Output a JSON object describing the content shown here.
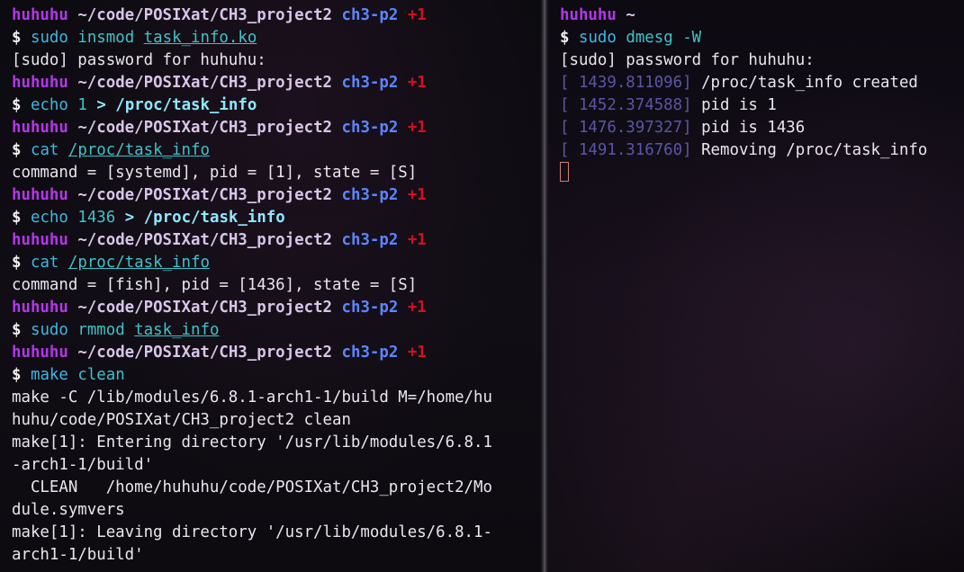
{
  "left": {
    "prompt": {
      "user": "huhuhu",
      "path": "~/code/POSIXat/CH3_project2",
      "branch": "ch3-p2",
      "dirty": "+1",
      "symbol": "$"
    },
    "cmd1": {
      "cmd": "sudo",
      "arg": "insmod",
      "target": "task_info.ko"
    },
    "out1": "[sudo] password for huhuhu:",
    "cmd2": {
      "cmd": "echo",
      "arg": "1",
      "op": ">",
      "target": "/proc/task_info"
    },
    "cmd3": {
      "cmd": "cat",
      "target": "/proc/task_info"
    },
    "out3": "command = [systemd], pid = [1], state = [S]",
    "cmd4": {
      "cmd": "echo",
      "arg": "1436",
      "op": ">",
      "target": "/proc/task_info"
    },
    "cmd5": {
      "cmd": "cat",
      "target": "/proc/task_info"
    },
    "out5": "command = [fish], pid = [1436], state = [S]",
    "cmd6": {
      "cmd": "sudo",
      "arg": "rmmod",
      "target": "task_info"
    },
    "cmd7": {
      "cmd": "make",
      "arg": "clean"
    },
    "out7": [
      "make -C /lib/modules/6.8.1-arch1-1/build M=/home/hu",
      "huhu/code/POSIXat/CH3_project2 clean",
      "make[1]: Entering directory '/usr/lib/modules/6.8.1",
      "-arch1-1/build'",
      "  CLEAN   /home/huhuhu/code/POSIXat/CH3_project2/Mo",
      "dule.symvers",
      "make[1]: Leaving directory '/usr/lib/modules/6.8.1-",
      "arch1-1/build'"
    ]
  },
  "right": {
    "prompt": {
      "user": "huhuhu",
      "path": "~",
      "symbol": "$"
    },
    "cmd": {
      "cmd": "sudo",
      "arg": "dmesg",
      "flag": "-W"
    },
    "out1": "[sudo] password for huhuhu:",
    "log": [
      {
        "ts": "[ 1439.811096]",
        "msg": "/proc/task_info created"
      },
      {
        "ts": "[ 1452.374588]",
        "msg": "pid is 1"
      },
      {
        "ts": "[ 1476.397327]",
        "msg": "pid is 1436"
      },
      {
        "ts": "[ 1491.316760]",
        "msg": "Removing /proc/task_info"
      }
    ]
  }
}
